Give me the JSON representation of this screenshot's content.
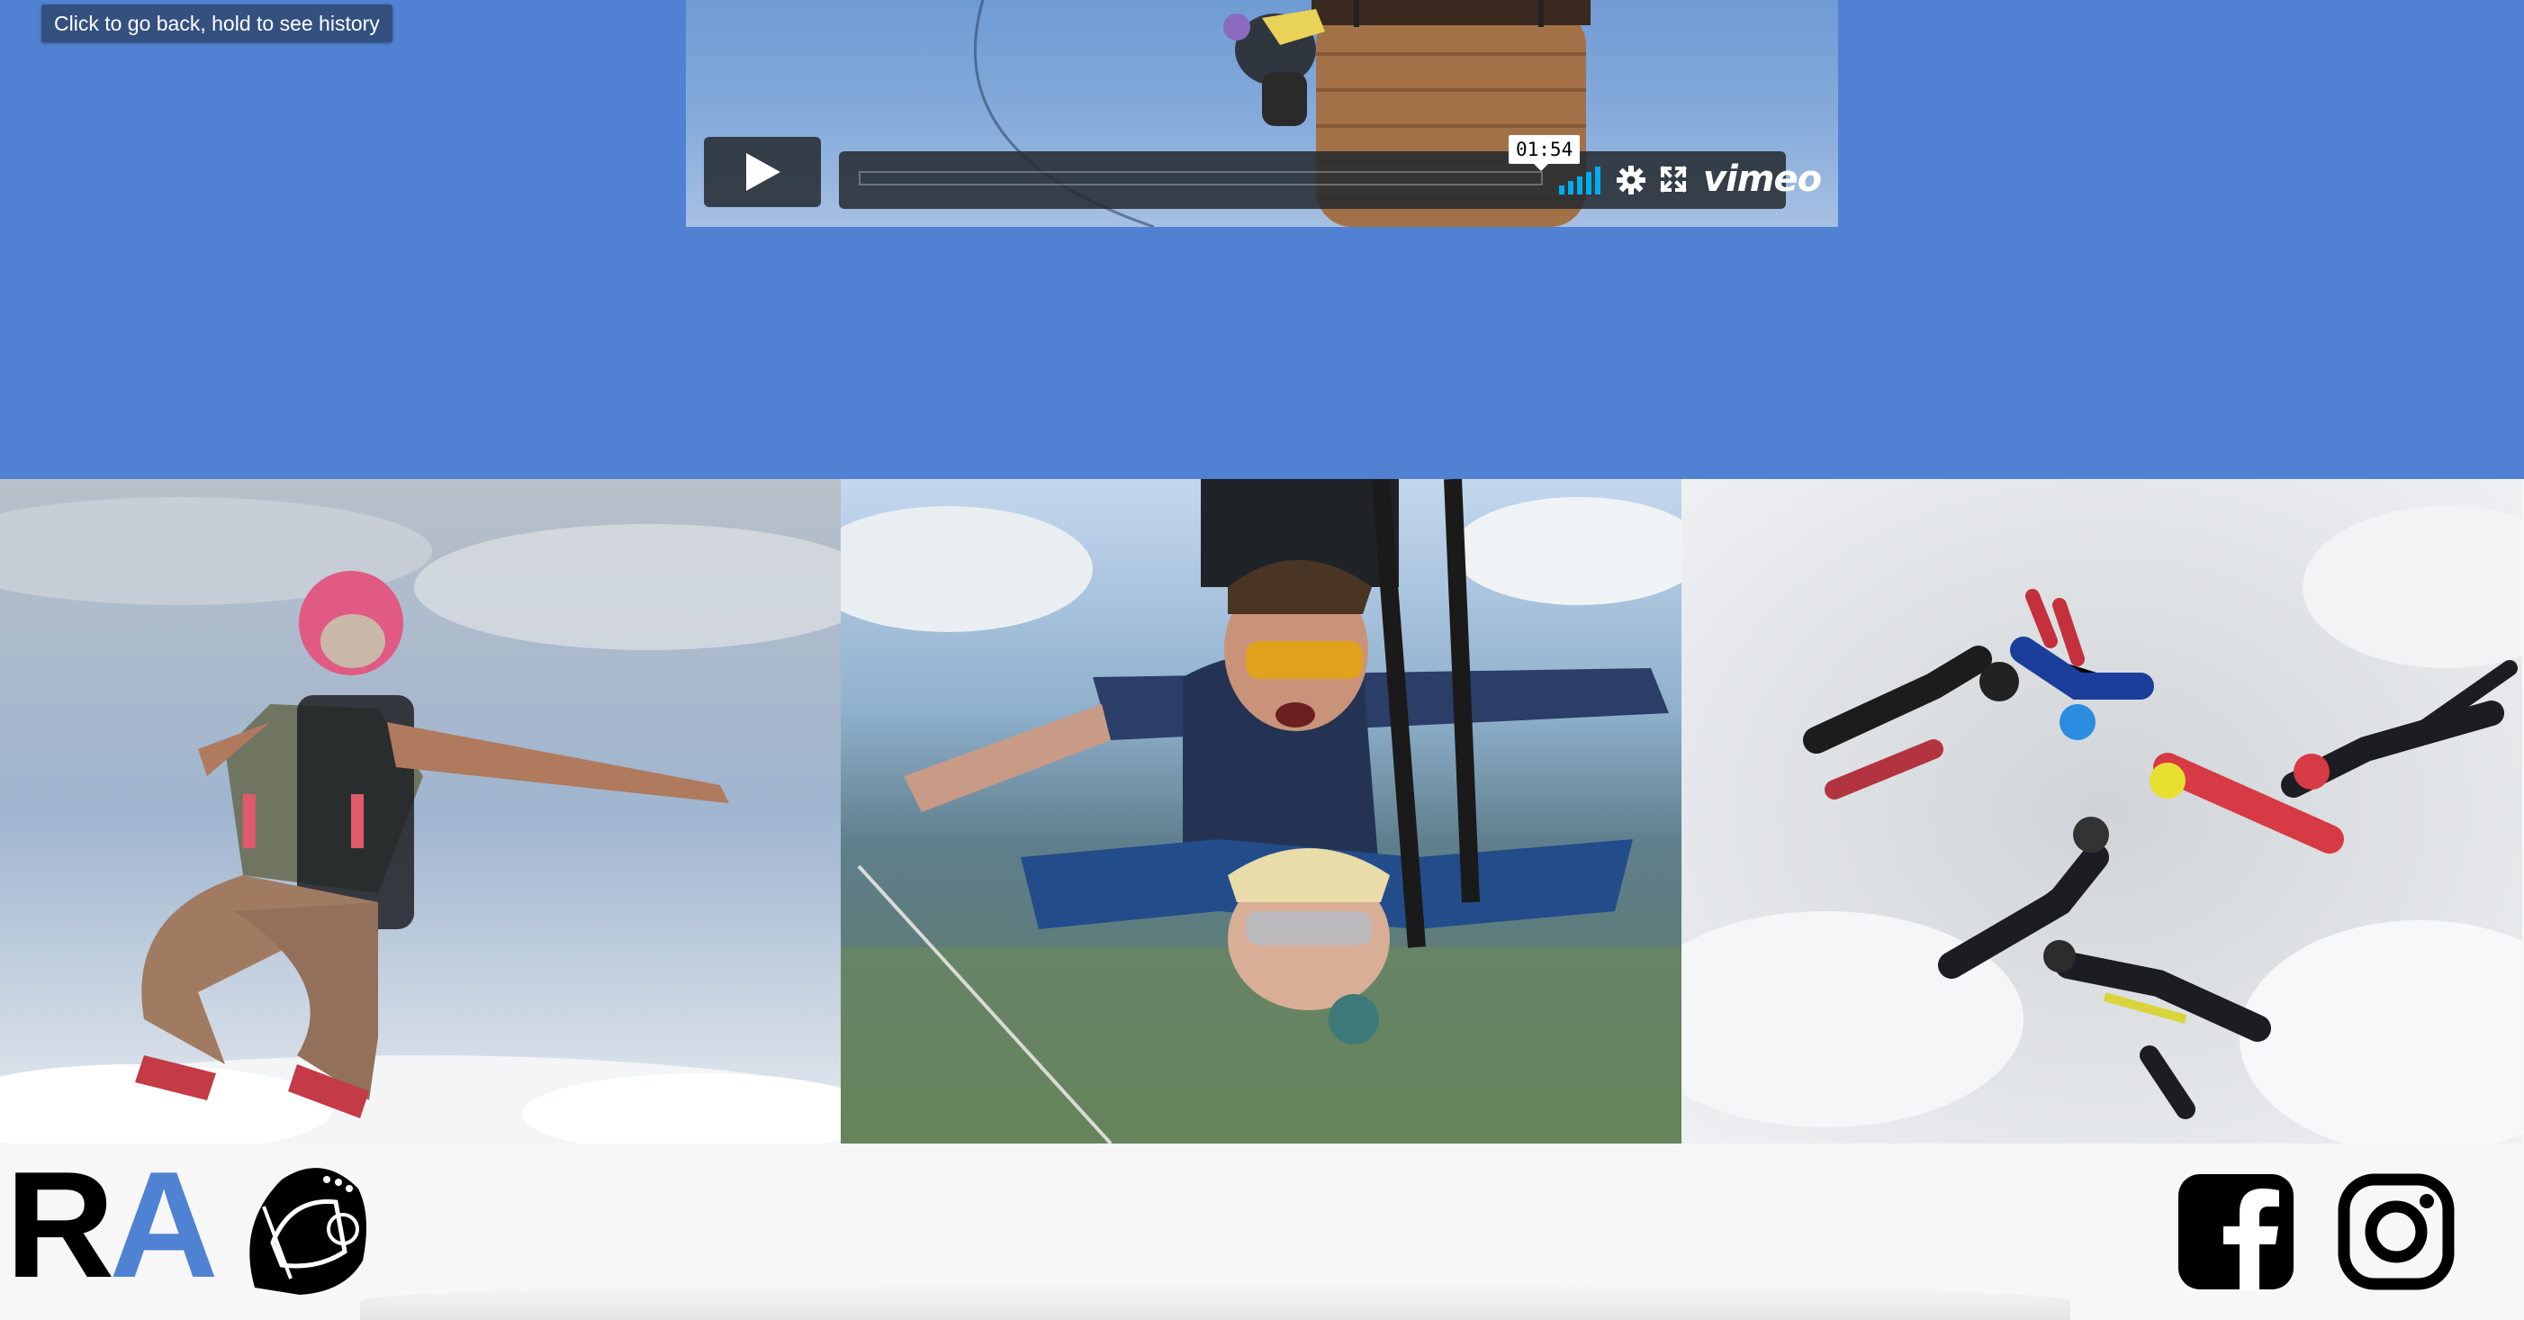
{
  "tooltip": {
    "text": "Click to go back, hold to see history"
  },
  "player": {
    "brand": "vimeo",
    "hover_time": "01:54",
    "progress": 0
  },
  "gallery": {
    "items": [
      {
        "name": "skydiver-pink-helmet-photo"
      },
      {
        "name": "tandem-skydive-photo"
      },
      {
        "name": "formation-skydivers-photo"
      }
    ]
  },
  "footer": {
    "logo": {
      "letters": [
        "R",
        "A"
      ]
    },
    "social": [
      {
        "icon": "facebook-icon"
      },
      {
        "icon": "instagram-icon"
      }
    ]
  },
  "colors": {
    "hero_bg": "#5081d3",
    "tooltip_bg": "#33507f",
    "logo_accent": "#4f82d3",
    "footer_bg": "#f7f7f7",
    "player_accent": "#00adef"
  }
}
